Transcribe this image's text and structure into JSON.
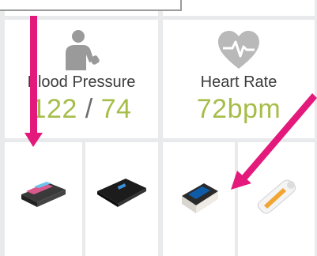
{
  "metrics": {
    "blood_pressure": {
      "label": "Blood Pressure",
      "systolic": "122",
      "separator": "/",
      "diastolic": "74"
    },
    "heart_rate": {
      "label": "Heart Rate",
      "value": "72bpm"
    }
  },
  "devices": [
    {
      "icon": "blood-pressure-monitor-icon"
    },
    {
      "icon": "smart-scale-icon"
    },
    {
      "icon": "pulse-oximeter-icon"
    },
    {
      "icon": "spirometer-icon"
    }
  ],
  "colors": {
    "value_green": "#a6bd4a",
    "arrow_pink": "#e3197b",
    "background": "#e9eaec"
  }
}
